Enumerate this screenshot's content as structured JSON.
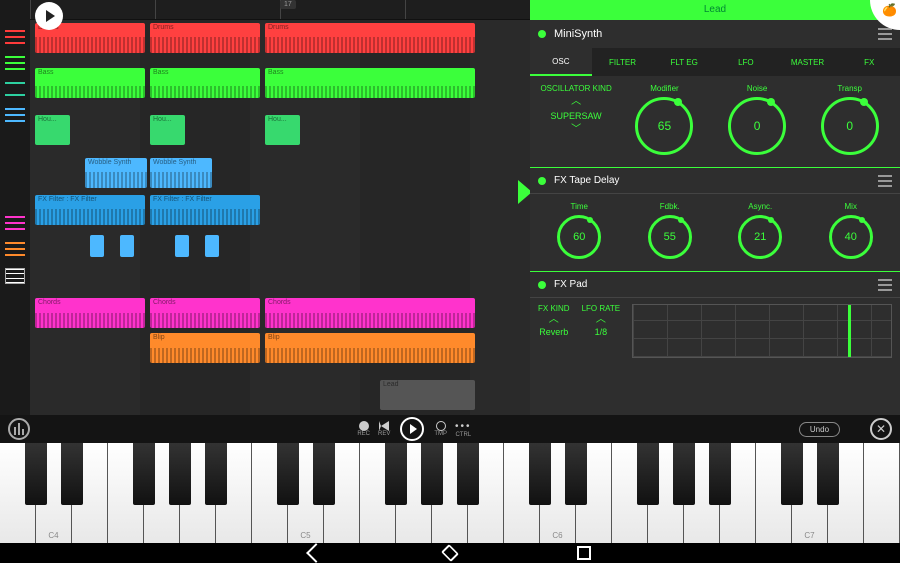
{
  "ruler": {
    "bar": "17"
  },
  "tracks": {
    "drums": "Drums",
    "bass": "Bass",
    "hou": "Hou...",
    "wobble": "Wobble Synth",
    "fxfilter": "FX Filter : FX Filter",
    "chords": "Chords",
    "blip": "Blip",
    "lead": "Lead"
  },
  "panel": {
    "title": "Lead",
    "minisynth": {
      "name": "MiniSynth",
      "tabs": [
        "OSC",
        "FILTER",
        "FLT EG",
        "LFO",
        "MASTER",
        "FX"
      ],
      "active_tab": 0,
      "osc_kind_label": "OSCILLATOR KIND",
      "osc_value": "SUPERSAW",
      "knobs": [
        {
          "label": "Modifier",
          "value": "65"
        },
        {
          "label": "Noise",
          "value": "0"
        },
        {
          "label": "Transp",
          "value": "0"
        }
      ]
    },
    "tapedelay": {
      "name": "FX Tape Delay",
      "knobs": [
        {
          "label": "Time",
          "value": "60"
        },
        {
          "label": "Fdbk.",
          "value": "55"
        },
        {
          "label": "Async.",
          "value": "21"
        },
        {
          "label": "Mix",
          "value": "40"
        }
      ]
    },
    "fxpad": {
      "name": "FX Pad",
      "fxkind_label": "FX KIND",
      "fxkind_value": "Reverb",
      "lforate_label": "LFO RATE",
      "lforate_value": "1/8"
    }
  },
  "transport": {
    "rec": "REC",
    "rev": "REV",
    "tmp": "TMP",
    "ctrl": "CTRL",
    "undo": "Undo"
  },
  "piano": {
    "octaves": [
      "C4",
      "C5",
      "C6",
      "C7"
    ]
  }
}
